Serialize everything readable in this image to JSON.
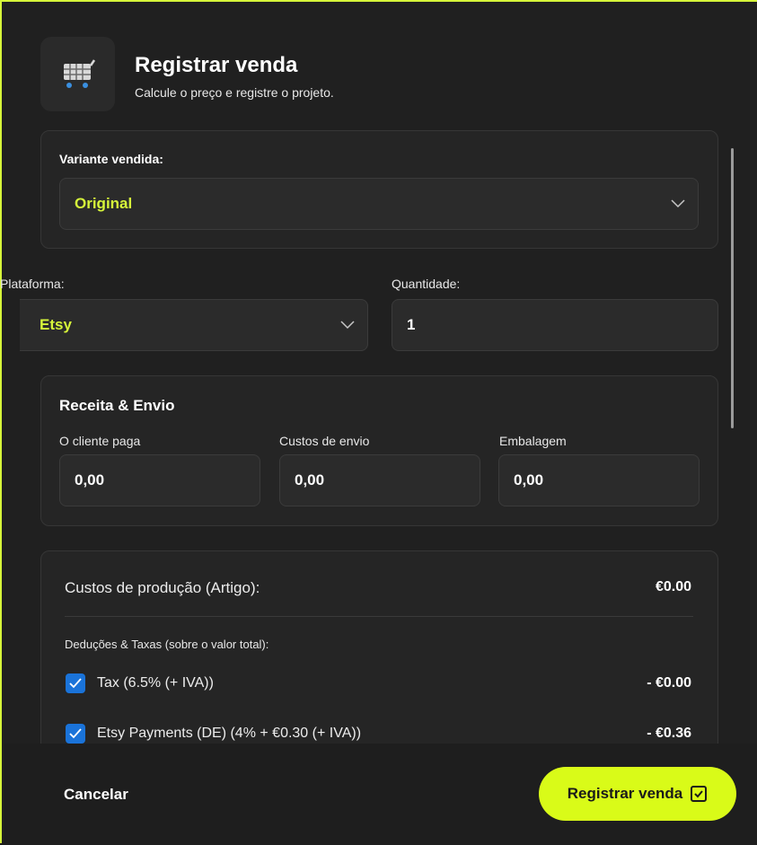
{
  "header": {
    "title": "Registrar venda",
    "subtitle": "Calcule o preço e registre o projeto.",
    "icon": "shopping-cart-icon"
  },
  "variant": {
    "label": "Variante vendida:",
    "value": "Original"
  },
  "platform": {
    "label": "Plataforma:",
    "value": "Etsy"
  },
  "quantity": {
    "label": "Quantidade:",
    "value": "1"
  },
  "revenue": {
    "title": "Receita & Envio",
    "fields": [
      {
        "label": "O cliente paga",
        "value": "0,00"
      },
      {
        "label": "Custos de envio",
        "value": "0,00"
      },
      {
        "label": "Embalagem",
        "value": "0,00"
      }
    ]
  },
  "summary": {
    "production_label": "Custos de produção (Artigo):",
    "production_value": "€0.00",
    "deductions_label": "Deduções & Taxas (sobre o valor total):",
    "items": [
      {
        "label": "Tax (6.5% (+ IVA))",
        "value": "- €0.00",
        "checked": true
      },
      {
        "label": "Etsy Payments (DE) (4% + €0.30 (+ IVA))",
        "value": "- €0.36",
        "checked": true
      }
    ]
  },
  "footer": {
    "cancel_label": "Cancelar",
    "submit_label": "Registrar venda"
  },
  "colors": {
    "accent": "#d6f53a",
    "primary_button": "#d9fb18",
    "checkbox": "#1a73d9",
    "background": "#202020"
  }
}
